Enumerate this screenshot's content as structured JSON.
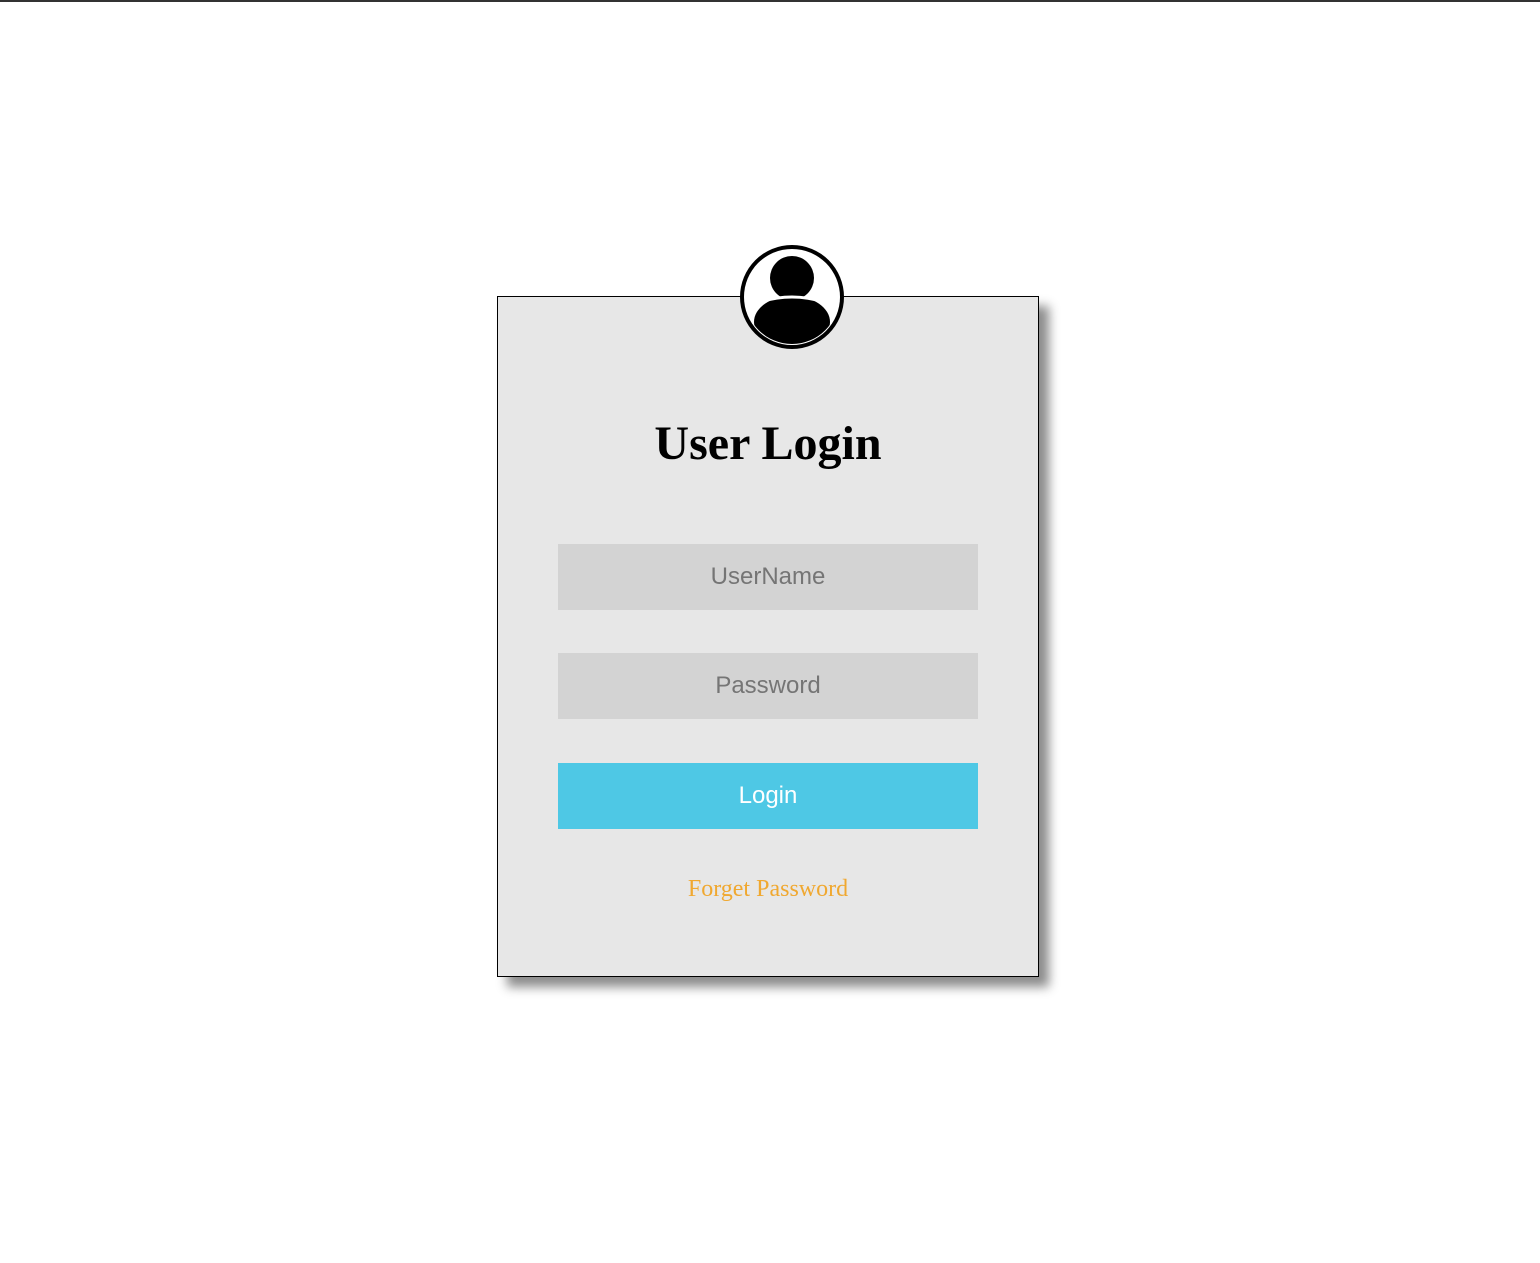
{
  "login_form": {
    "title": "User Login",
    "username_placeholder": "UserName",
    "password_placeholder": "Password",
    "login_label": "Login",
    "forgot_label": "Forget Password"
  },
  "icons": {
    "avatar": "user-circle-icon"
  },
  "colors": {
    "card_bg": "#e7e7e7",
    "input_bg": "#d3d3d3",
    "login_button": "#4ec8e5",
    "forgot_link": "#f0a830"
  }
}
